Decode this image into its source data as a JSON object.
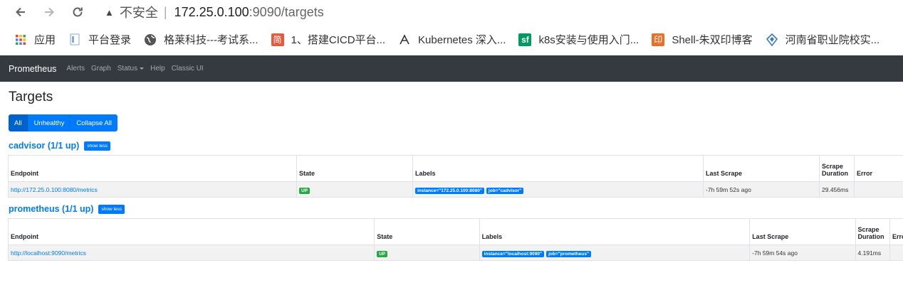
{
  "browser": {
    "insecure_label": "不安全",
    "url_host": "172.25.0.100",
    "url_rest": ":9090/targets",
    "bookmarks": [
      {
        "label": "应用",
        "icon": "apps-grid-icon",
        "color": "#e94235"
      },
      {
        "label": "平台登录",
        "icon": "page-icon",
        "color": "#5f8fd6"
      },
      {
        "label": "格莱科技---考试系...",
        "icon": "globe-icon",
        "color": "#555555"
      },
      {
        "label": "1、搭建CICD平台...",
        "icon": "jianshu-icon",
        "color": "#e9583d"
      },
      {
        "label": "Kubernetes 深入...",
        "icon": "juejin-icon",
        "color": "#333333"
      },
      {
        "label": "k8s安装与使用入门...",
        "icon": "segmentfault-icon",
        "color": "#009a61"
      },
      {
        "label": "Shell-朱双印博客",
        "icon": "zsythink-icon",
        "color": "#e8702a"
      },
      {
        "label": "河南省职业院校实...",
        "icon": "shield-site-icon",
        "color": "#3a7bbf"
      }
    ]
  },
  "navbar": {
    "brand": "Prometheus",
    "links": [
      "Alerts",
      "Graph",
      "Status",
      "Help",
      "Classic UI"
    ]
  },
  "page": {
    "title": "Targets",
    "filters": [
      "All",
      "Unhealthy",
      "Collapse All"
    ]
  },
  "columns": {
    "endpoint": "Endpoint",
    "state": "State",
    "labels": "Labels",
    "last_scrape": "Last Scrape",
    "scrape_duration_1": "Scrape",
    "scrape_duration_2": "Duration",
    "error": "Error"
  },
  "jobs": [
    {
      "title": "cadvisor (1/1 up)",
      "toggle": "show less",
      "endpoint": "http://172.25.0.100:8080/metrics",
      "state": "UP",
      "labels": [
        "instance=\"172.25.0.100:8080\"",
        "job=\"cadvisor\""
      ],
      "last_scrape": "-7h 59m 52s ago",
      "duration": "29.456ms",
      "error": ""
    },
    {
      "title": "prometheus (1/1 up)",
      "toggle": "show less",
      "endpoint": "http://localhost:9090/metrics",
      "state": "UP",
      "labels": [
        "instance=\"localhost:9090\"",
        "job=\"prometheus\""
      ],
      "last_scrape": "-7h 59m 54s ago",
      "duration": "4.191ms",
      "error": ""
    }
  ]
}
